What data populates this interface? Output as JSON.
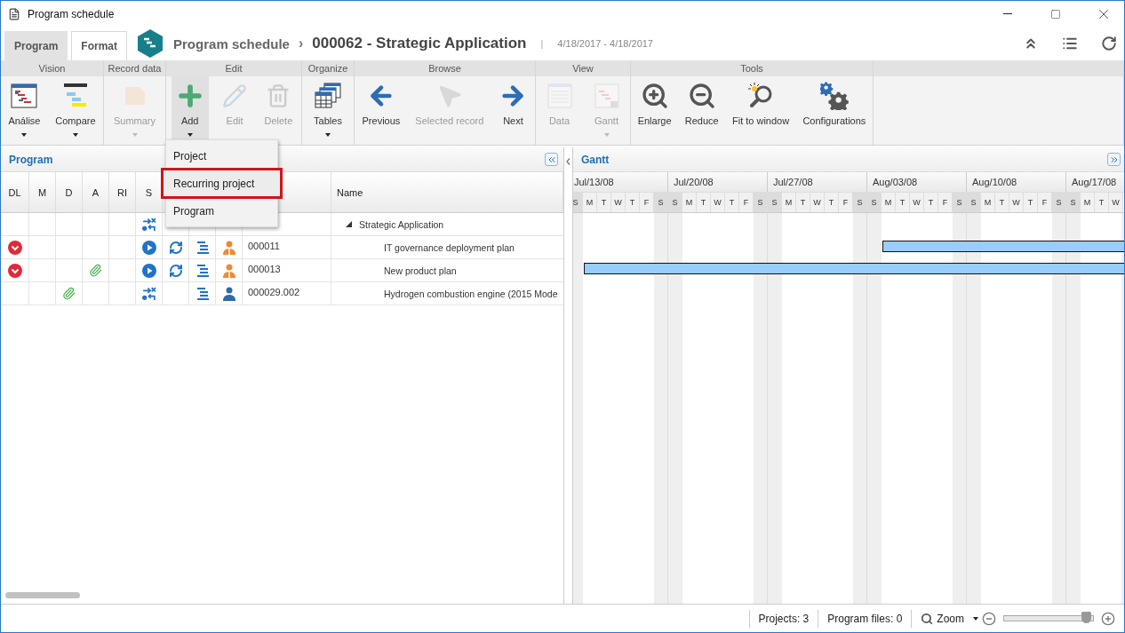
{
  "window": {
    "title": "Program schedule"
  },
  "tabs": [
    {
      "label": "Program",
      "selected": true
    },
    {
      "label": "Format",
      "selected": false
    }
  ],
  "breadcrumb": {
    "section": "Program schedule",
    "separator": "›",
    "record": "000062 - Strategic Application",
    "divider": "|",
    "dates": "4/18/2017 - 4/18/2017"
  },
  "ribbon": [
    {
      "label": "Vision",
      "buttons": [
        {
          "kind": "analysis",
          "label": "Análise",
          "disabled": false,
          "dropdown": true,
          "pressed": false
        },
        {
          "kind": "compare",
          "label": "Compare",
          "disabled": false,
          "dropdown": true,
          "pressed": false
        }
      ]
    },
    {
      "label": "Record data",
      "buttons": [
        {
          "kind": "summary",
          "label": "Summary",
          "disabled": true,
          "dropdown": true,
          "pressed": false
        }
      ]
    },
    {
      "label": "Edit",
      "buttons": [
        {
          "kind": "add",
          "label": "Add",
          "disabled": false,
          "dropdown": true,
          "pressed": true
        },
        {
          "kind": "edit",
          "label": "Edit",
          "disabled": true,
          "dropdown": false,
          "pressed": false
        },
        {
          "kind": "delete",
          "label": "Delete",
          "disabled": true,
          "dropdown": false,
          "pressed": false
        }
      ]
    },
    {
      "label": "Organize",
      "buttons": [
        {
          "kind": "tables",
          "label": "Tables",
          "disabled": false,
          "dropdown": true,
          "pressed": false
        }
      ]
    },
    {
      "label": "Browse",
      "buttons": [
        {
          "kind": "previous",
          "label": "Previous",
          "disabled": false,
          "dropdown": false,
          "pressed": false
        },
        {
          "kind": "pointer",
          "label": "Selected record",
          "disabled": true,
          "dropdown": false,
          "pressed": false
        },
        {
          "kind": "next",
          "label": "Next",
          "disabled": false,
          "dropdown": false,
          "pressed": false
        }
      ]
    },
    {
      "label": "View",
      "buttons": [
        {
          "kind": "data",
          "label": "Data",
          "disabled": true,
          "dropdown": false,
          "pressed": false
        },
        {
          "kind": "gantt",
          "label": "Gantt",
          "disabled": true,
          "dropdown": true,
          "pressed": false
        }
      ]
    },
    {
      "label": "Tools",
      "buttons": [
        {
          "kind": "enlarge",
          "label": "Enlarge",
          "disabled": false,
          "dropdown": false,
          "pressed": false
        },
        {
          "kind": "reduce",
          "label": "Reduce",
          "disabled": false,
          "dropdown": false,
          "pressed": false
        },
        {
          "kind": "fit",
          "label": "Fit to window",
          "disabled": false,
          "dropdown": false,
          "pressed": false
        },
        {
          "kind": "config",
          "label": "Configurations",
          "disabled": false,
          "dropdown": false,
          "pressed": false
        }
      ]
    }
  ],
  "add_menu": {
    "items": [
      {
        "label": "Project",
        "selected": false
      },
      {
        "label": "Recurring project",
        "selected": true
      },
      {
        "label": "Program",
        "selected": false
      }
    ]
  },
  "program_panel": {
    "title": "Program",
    "columns": [
      {
        "label": "DL"
      },
      {
        "label": "M"
      },
      {
        "label": "D"
      },
      {
        "label": "A"
      },
      {
        "label": "RI"
      },
      {
        "label": "S"
      },
      {},
      {},
      {},
      {},
      {
        "label": "Name"
      }
    ],
    "rows": [
      {
        "name": "Strategic Application",
        "expanded": true,
        "overdue": false,
        "document": false,
        "attachment": false,
        "started": false,
        "transfer": true,
        "recurring": false,
        "tasks": false,
        "team_owner": false,
        "person_owner": false,
        "children": [
          {
            "id": "000011",
            "name": "IT governance deployment plan",
            "overdue": true,
            "document": false,
            "attachment": false,
            "started": true,
            "transfer": false,
            "recurring": true,
            "tasks": true,
            "team_owner": true,
            "person_owner": false
          },
          {
            "id": "000013",
            "name": "New product plan",
            "overdue": true,
            "document": false,
            "attachment": true,
            "started": true,
            "transfer": false,
            "recurring": true,
            "tasks": true,
            "team_owner": true,
            "person_owner": false
          },
          {
            "id": "000029.002",
            "name": "Hydrogen combustion engine (2015 Mode",
            "overdue": false,
            "document": true,
            "attachment": false,
            "started": false,
            "transfer": true,
            "recurring": false,
            "tasks": true,
            "team_owner": false,
            "person_owner": true
          }
        ]
      }
    ]
  },
  "gantt": {
    "title": "Gantt",
    "weeks": [
      {
        "label": "Jul/13/08",
        "days": [
          "S",
          "M",
          "T",
          "W",
          "T",
          "F",
          "S"
        ]
      },
      {
        "label": "Jul/20/08",
        "days": [
          "S",
          "M",
          "T",
          "W",
          "T",
          "F",
          "S"
        ]
      },
      {
        "label": "Jul/27/08",
        "days": [
          "S",
          "M",
          "T",
          "W",
          "T",
          "F",
          "S"
        ]
      },
      {
        "label": "Aug/03/08",
        "days": [
          "S",
          "M",
          "T",
          "W",
          "T",
          "F",
          "S"
        ]
      },
      {
        "label": "Aug/10/08",
        "days": [
          "S",
          "M",
          "T",
          "W",
          "T",
          "F",
          "S"
        ]
      },
      {
        "label": "Aug/17/08",
        "days": [
          "S",
          "M",
          "T",
          "W"
        ]
      }
    ],
    "rows": [
      {
        "bar": false
      },
      {
        "bar": true,
        "level": 0.44
      },
      {
        "bar": true,
        "level": 0.98
      },
      {
        "bar": false
      }
    ]
  },
  "status_bar": {
    "projects_label": "Projects:",
    "projects": "3",
    "files_label": "Program files:",
    "files": "0",
    "zoom_label": "Zoom",
    "zoom": {
      "level": 0.93
    }
  }
}
